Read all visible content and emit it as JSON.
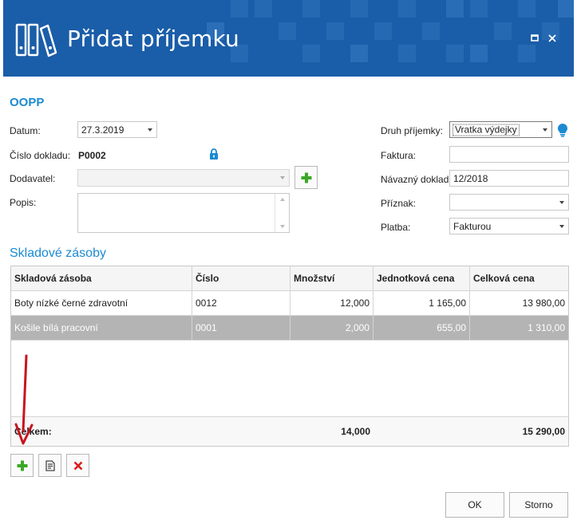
{
  "window": {
    "title": "Přidat příjemku"
  },
  "section1": {
    "title": "OOPP"
  },
  "form": {
    "datum": {
      "label": "Datum:",
      "value": "27.3.2019"
    },
    "cislo_dokladu": {
      "label": "Číslo dokladu:",
      "value": "P0002"
    },
    "dodavatel": {
      "label": "Dodavatel:",
      "value": ""
    },
    "popis": {
      "label": "Popis:",
      "value": ""
    },
    "druh_prijemky": {
      "label": "Druh příjemky:",
      "value": "Vratka výdejky"
    },
    "faktura": {
      "label": "Faktura:",
      "value": ""
    },
    "navazny_doklad": {
      "label": "Návazný doklad:",
      "value": "12/2018"
    },
    "priznak": {
      "label": "Příznak:",
      "value": ""
    },
    "platba": {
      "label": "Platba:",
      "value": "Fakturou"
    }
  },
  "section2": {
    "title": "Skladové zásoby"
  },
  "table": {
    "columns": [
      "Skladová zásoba",
      "Číslo",
      "Množství",
      "Jednotková cena",
      "Celková cena"
    ],
    "rows": [
      {
        "name": "Boty nízké černé zdravotní",
        "cislo": "0012",
        "mnozstvi": "12,000",
        "jednotkova": "1 165,00",
        "celkova": "13 980,00"
      },
      {
        "name": "Košile bílá pracovní",
        "cislo": "0001",
        "mnozstvi": "2,000",
        "jednotkova": "655,00",
        "celkova": "1 310,00"
      }
    ],
    "footer": {
      "label": "Celkem:",
      "mnozstvi": "14,000",
      "celkova": "15 290,00"
    }
  },
  "buttons": {
    "ok": "OK",
    "storno": "Storno"
  },
  "colors": {
    "titlebar": "#1a5da8",
    "accent": "#1b8ad1",
    "add_green": "#3aa827",
    "delete_red": "#d9201c",
    "annotation_arrow": "#c8141e",
    "selected_row": "#b4b4b4"
  }
}
